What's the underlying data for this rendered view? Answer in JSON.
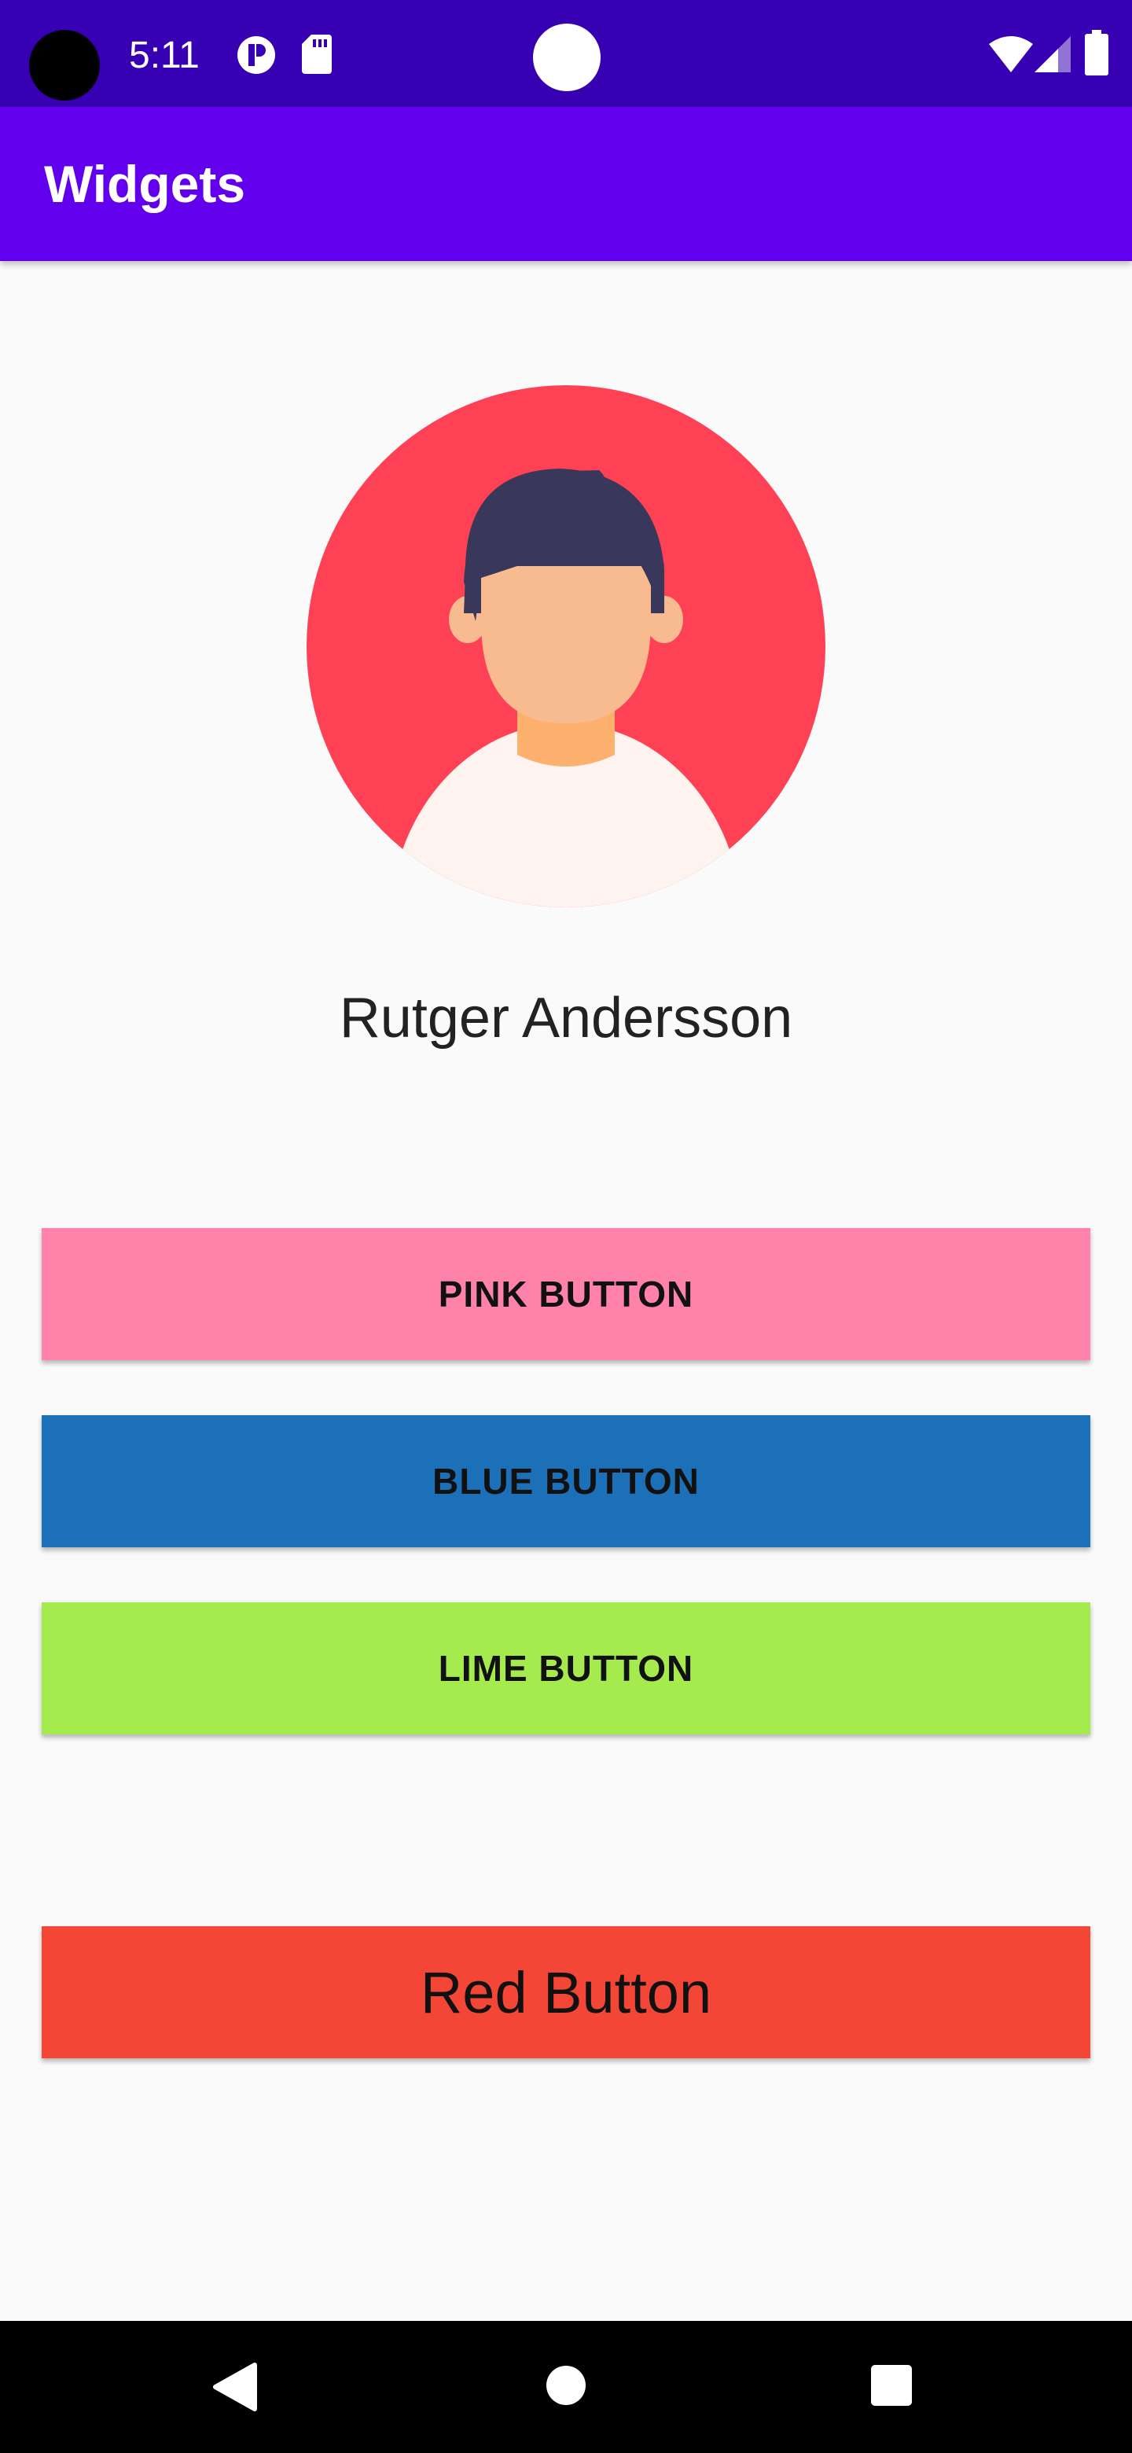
{
  "status_bar": {
    "time": "5:11",
    "background": "#3700b3",
    "icons": [
      "camera-cutout",
      "pill-notification-icon",
      "sd-card-icon",
      "center-dot",
      "wifi-icon",
      "signal-icon",
      "battery-icon"
    ]
  },
  "app_bar": {
    "title": "Widgets",
    "background": "#6200ee"
  },
  "profile": {
    "name": "Rutger Andersson",
    "avatar_icon": "person-avatar-icon",
    "avatar_colors": {
      "background": "#ff4155",
      "hair": "#39375a",
      "skin": "#f7bb8f",
      "neck": "#feb16e",
      "shirt": "#fff3ef"
    }
  },
  "buttons": [
    {
      "label": "PINK BUTTON",
      "color": "#ff82ab"
    },
    {
      "label": "BLUE BUTTON",
      "color": "#1b70b7"
    },
    {
      "label": "LIME BUTTON",
      "color": "#a5eb4e"
    },
    {
      "label": "Red Button",
      "color": "#f44637"
    }
  ],
  "nav_bar": {
    "icons": [
      "back-icon",
      "home-icon",
      "recents-icon"
    ]
  }
}
